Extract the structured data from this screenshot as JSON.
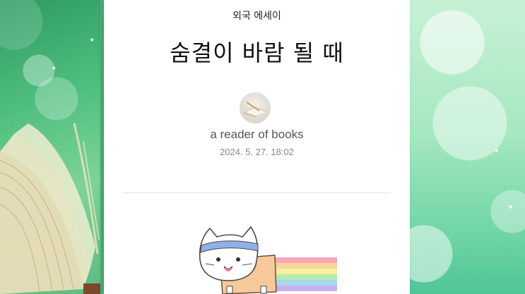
{
  "post": {
    "category": "외국 에세이",
    "title": "숨결이 바람 될 때",
    "author": "a reader of books",
    "datetime": "2024. 5. 27. 18:02"
  },
  "icons": {
    "avatar": "book-avatar-icon",
    "illustration": "nyan-cat-emoticon"
  },
  "colors": {
    "background_green": "#5cc488",
    "card": "#ffffff",
    "title_text": "#111111",
    "meta_text": "#888888"
  }
}
